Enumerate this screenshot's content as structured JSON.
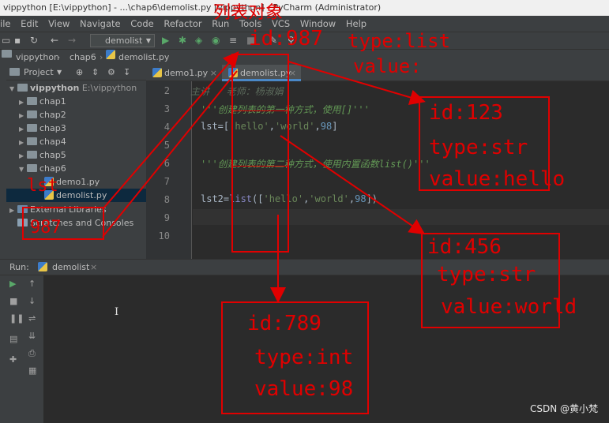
{
  "window": {
    "title_left": "vippython [E:\\vippython] - ...\\chap6\\demolist.py [vippython] - PyCharm (Administrator)"
  },
  "menu": [
    "ile",
    "Edit",
    "View",
    "Navigate",
    "Code",
    "Refactor",
    "Run",
    "Tools",
    "VCS",
    "Window",
    "Help"
  ],
  "toolbar": {
    "run_config": "demolist"
  },
  "breadcrumb": [
    "vippython",
    "chap6",
    "demolist.py"
  ],
  "project_panel": {
    "title": "Project",
    "root_name": "vippython",
    "root_path": "E:\\vippython",
    "folders": [
      "chap1",
      "chap2",
      "chap3",
      "chap4",
      "chap5",
      "chap6"
    ],
    "files": [
      "demo1.py",
      "demolist.py"
    ],
    "external": "External Libraries",
    "scratches": "Scratches and Consoles"
  },
  "tabs": [
    "demo1.py",
    "demolist.py"
  ],
  "editor": {
    "line_numbers": [
      "2",
      "3",
      "4",
      "5",
      "6",
      "7",
      "8",
      "9",
      "10"
    ],
    "line2": "主讲   老师：杨淑娟",
    "line3": "'''创建列表的第一种方式，使用[]'''",
    "line4_prefix": "lst=[",
    "line4_s1": "'hello'",
    "line4_comma1": ",",
    "line4_s2": "'world'",
    "line4_comma2": ",",
    "line4_n": "98",
    "line4_suffix": "]",
    "line6": "'''创建列表的第二种方式，使用内置函数list()'''",
    "line8_prefix": "lst2=",
    "line8_fn": "list",
    "line8_open": "([",
    "line8_s1": "'hello'",
    "line8_comma1": ",",
    "line8_s2": "'world'",
    "line8_comma2": ",",
    "line8_n": "98",
    "line8_suffix": "])"
  },
  "run_panel": {
    "label": "Run:",
    "config": "demolist"
  },
  "annotations": {
    "list_object_title": "列表对象",
    "list_id": "id:987",
    "list_type": "type:list",
    "list_value": "value:",
    "lst_label": "lst",
    "lst_id": "987",
    "box_hello": {
      "id": "id:123",
      "type": "type:str",
      "value": "value:hello"
    },
    "box_world": {
      "id": "id:456",
      "type": "type:str",
      "value": "value:world"
    },
    "box_98": {
      "id": "id:789",
      "type": "type:int",
      "value": "value:98"
    },
    "annotation_color": "#e00000"
  },
  "watermark": "CSDN @黄小梵"
}
